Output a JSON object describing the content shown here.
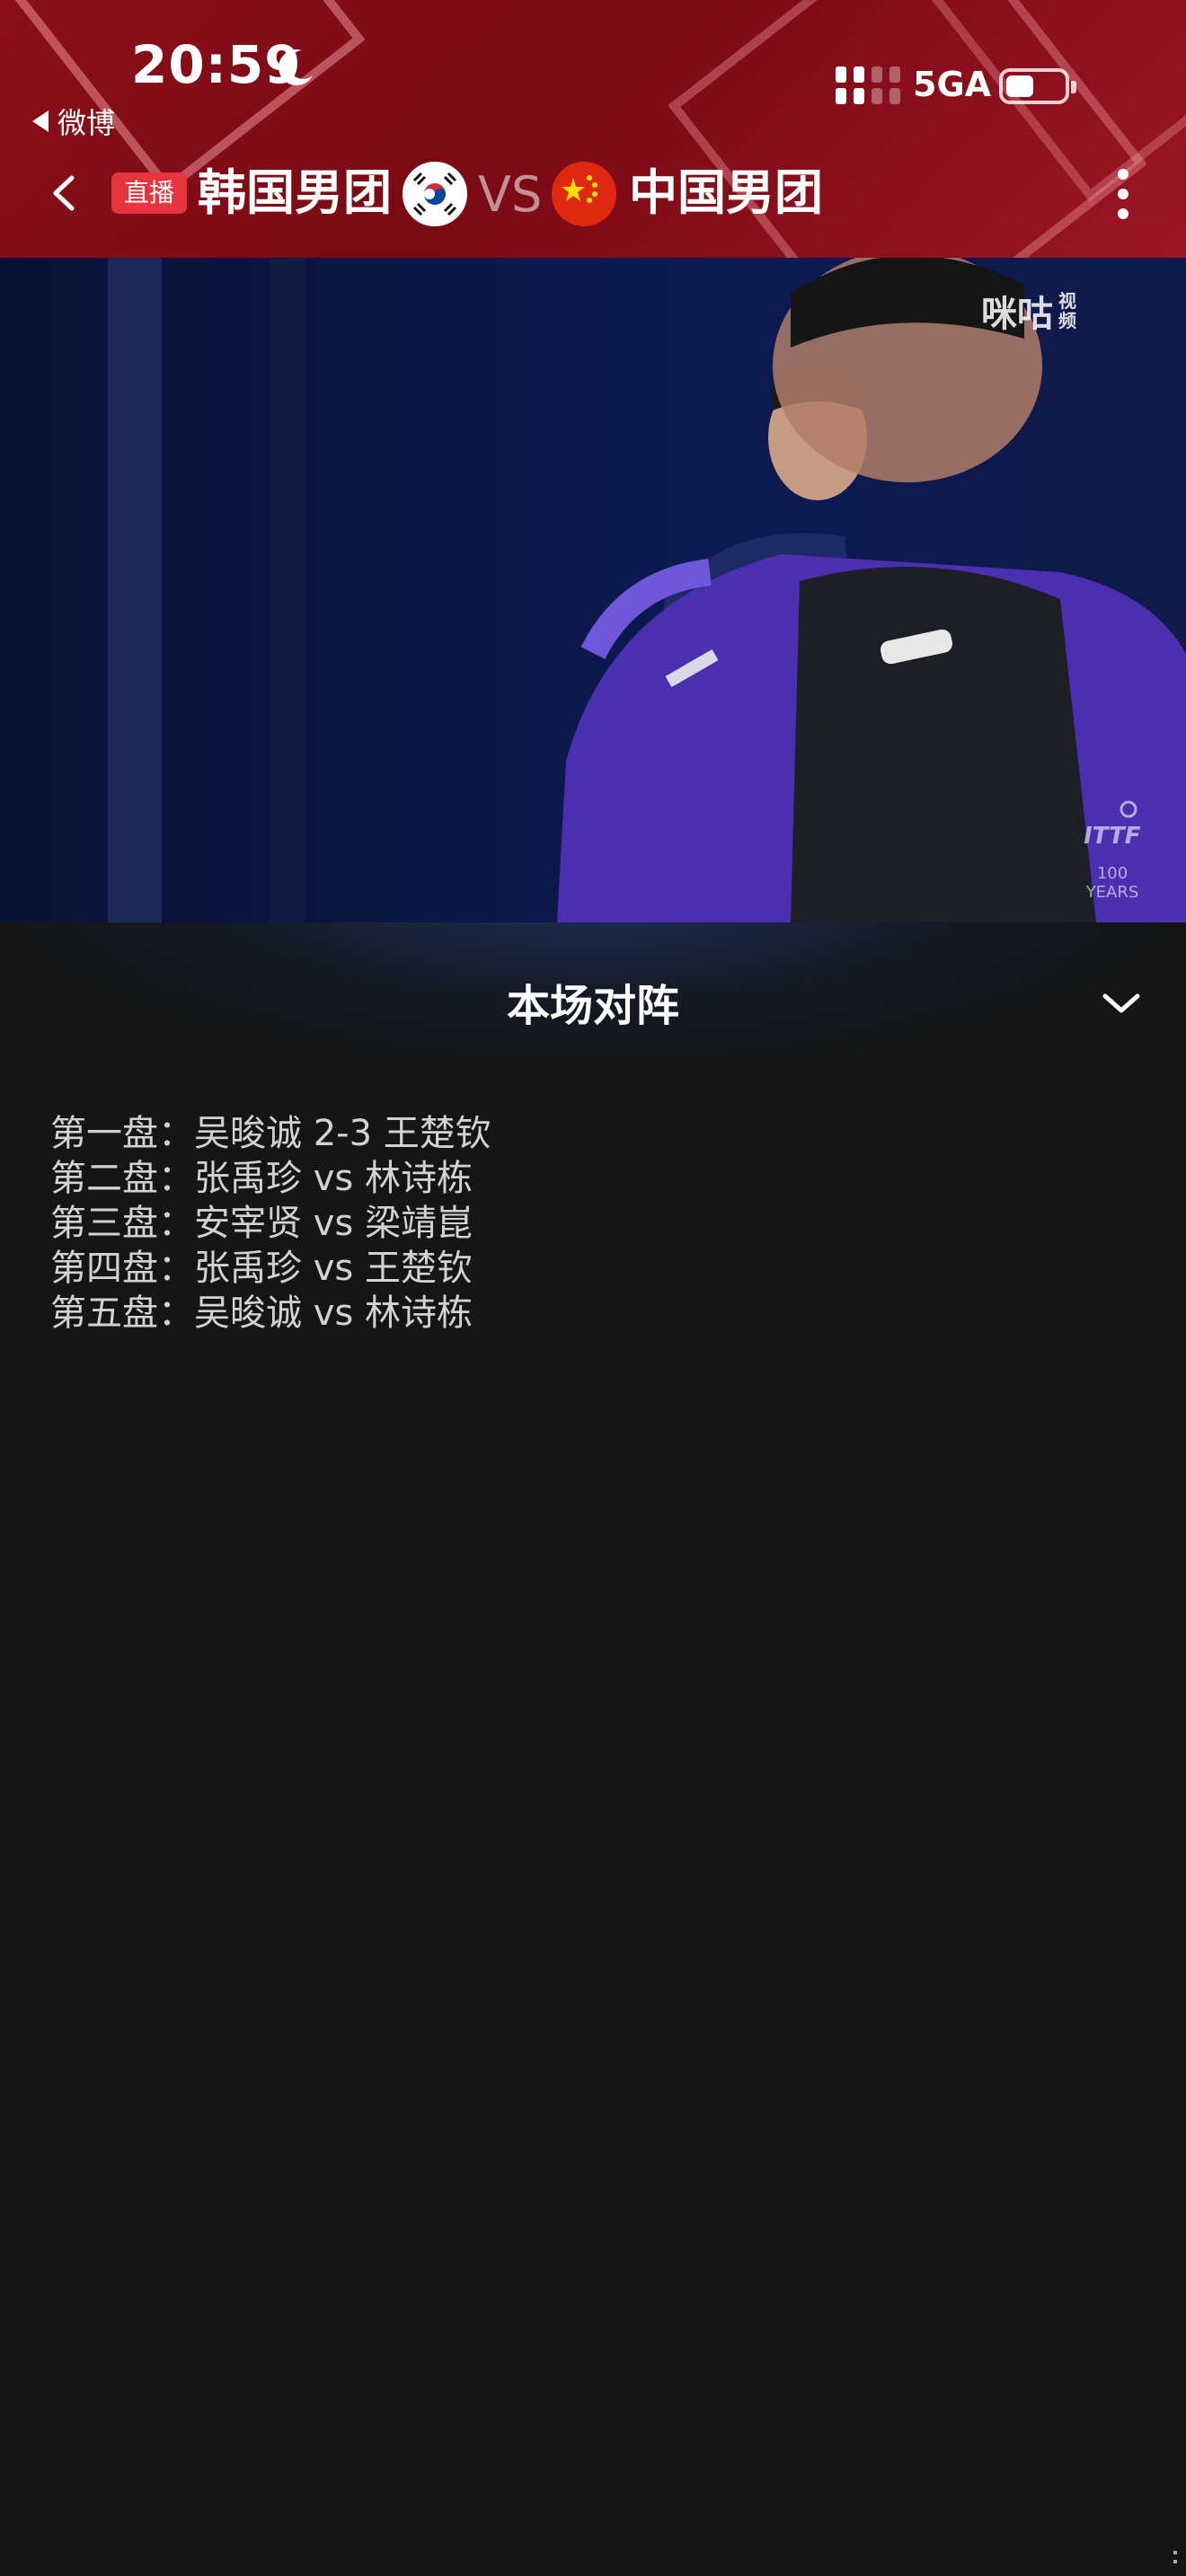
{
  "status_bar": {
    "time": "20:59",
    "back_app_label": "微博",
    "network": "5GA"
  },
  "header": {
    "live_badge": "直播",
    "team_left": "韩国男团",
    "vs": "VS",
    "team_right": "中国男团"
  },
  "video": {
    "watermark_brand": "咪咕",
    "watermark_sub": "视频",
    "ittf_label": "100 YEARS"
  },
  "panel": {
    "title": "本场对阵",
    "matches": [
      "第一盘：吴晙诚 2-3 王楚钦",
      "第二盘：张禹珍 vs 林诗栋",
      "第三盘：安宰贤 vs 梁靖崑",
      "第四盘：张禹珍 vs 王楚钦",
      "第五盘：吴晙诚 vs 林诗栋"
    ]
  },
  "colors": {
    "header_red": "#8a0f1a",
    "live_badge": "#e8343f",
    "panel_bg": "#151515",
    "match_text": "#d2d2d2"
  }
}
